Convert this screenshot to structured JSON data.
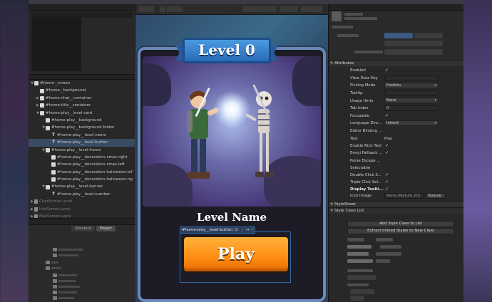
{
  "hierarchy": {
    "rows": [
      {
        "label": "#home-_screen",
        "indent": 0,
        "kind": "node",
        "arrow": "▼",
        "dim": false,
        "selected": false
      },
      {
        "label": "#home-_background",
        "indent": 1,
        "kind": "node",
        "arrow": "",
        "dim": false,
        "selected": false
      },
      {
        "label": "#home-chat__container",
        "indent": 1,
        "kind": "node",
        "arrow": "▶",
        "dim": false,
        "selected": false
      },
      {
        "label": "#home-title__container",
        "indent": 1,
        "kind": "node",
        "arrow": "▶",
        "dim": false,
        "selected": false
      },
      {
        "label": "#home-play__level-card",
        "indent": 1,
        "kind": "node",
        "arrow": "▼",
        "dim": false,
        "selected": false
      },
      {
        "label": "#home-play__background",
        "indent": 2,
        "kind": "node",
        "arrow": "",
        "dim": false,
        "selected": false
      },
      {
        "label": "#home-play__background-footer",
        "indent": 2,
        "kind": "node",
        "arrow": "▼",
        "dim": false,
        "selected": false
      },
      {
        "label": "#home-play__level-name",
        "indent": 3,
        "kind": "text",
        "arrow": "",
        "dim": false,
        "selected": false
      },
      {
        "label": "#home-play__level-button",
        "indent": 3,
        "kind": "text",
        "arrow": "",
        "dim": false,
        "selected": true
      },
      {
        "label": "#home-play__level-frame",
        "indent": 2,
        "kind": "node",
        "arrow": "▼",
        "dim": false,
        "selected": false
      },
      {
        "label": "#home-play__decoration-xmas-right",
        "indent": 3,
        "kind": "node",
        "arrow": "",
        "dim": false,
        "selected": false
      },
      {
        "label": "#home-play__decoration-xmas-left",
        "indent": 3,
        "kind": "node",
        "arrow": "",
        "dim": false,
        "selected": false
      },
      {
        "label": "#home-play__decoration-halloween-lef",
        "indent": 3,
        "kind": "node",
        "arrow": "",
        "dim": false,
        "selected": false
      },
      {
        "label": "#home-play__decoration-halloween-rig",
        "indent": 3,
        "kind": "node",
        "arrow": "",
        "dim": false,
        "selected": false
      },
      {
        "label": "#home-play__level-banner",
        "indent": 2,
        "kind": "node",
        "arrow": "▼",
        "dim": false,
        "selected": false
      },
      {
        "label": "#home-play__level-number",
        "indent": 3,
        "kind": "text",
        "arrow": "",
        "dim": false,
        "selected": false
      },
      {
        "label": "CharScreen.uxml",
        "indent": 0,
        "kind": "file",
        "arrow": "▶",
        "dim": true,
        "selected": false
      },
      {
        "label": "InfoScreen.uxml",
        "indent": 0,
        "kind": "file",
        "arrow": "▶",
        "dim": true,
        "selected": false
      },
      {
        "label": "MailScreen.uxml",
        "indent": 0,
        "kind": "file",
        "arrow": "▶",
        "dim": true,
        "selected": false
      }
    ]
  },
  "project": {
    "tabs": [
      "Standard",
      "Project"
    ]
  },
  "scene": {
    "level_title": "Level 0",
    "level_name": "Level Name",
    "play_label": "Play",
    "selection_tag": "#home-play__level-button",
    "tag_icons": [
      "⊡",
      "⋮",
      "↦",
      "⊺"
    ]
  },
  "inspector": {
    "attributes_header": "Attributes",
    "attributes": [
      {
        "label": "Enabled",
        "type": "check",
        "value": "✓"
      },
      {
        "label": "View Data Key",
        "type": "field",
        "value": ""
      },
      {
        "label": "Picking Mode",
        "type": "dropdown",
        "value": "Position"
      },
      {
        "label": "Tooltip",
        "type": "field",
        "value": ""
      },
      {
        "label": "Usage Hints",
        "type": "dropdown",
        "value": "None"
      },
      {
        "label": "Tab Index",
        "type": "field",
        "value": "0"
      },
      {
        "label": "Focusable",
        "type": "check",
        "value": "✓"
      },
      {
        "label": "Language Dire...",
        "type": "dropdown",
        "value": "Inherit"
      },
      {
        "label": "Editor Binding ...",
        "type": "none",
        "value": ""
      }
    ],
    "text_label": "Text",
    "text_value": "Play",
    "text_props": [
      {
        "label": "Enable Rich Text",
        "value": "✓",
        "bold": false
      },
      {
        "label": "Emoji Fallback ...",
        "value": "✓",
        "bold": false
      },
      {
        "label": "Parse Escape ...",
        "value": "",
        "bold": false
      },
      {
        "label": "Selectable",
        "value": "",
        "bold": false
      },
      {
        "label": "Double Click S...",
        "value": "✓",
        "bold": false
      },
      {
        "label": "Triple Click Sel...",
        "value": "✓",
        "bold": false
      },
      {
        "label": "Display Toolti...",
        "value": "✓",
        "bold": true
      }
    ],
    "icon_image_label": "Icon Image",
    "icon_image_value": "None (Texture 2D)",
    "icon_image_button": "Texture",
    "stylesheet_header": "StyleSheet",
    "style_class_list_header": "Style Class List",
    "add_class_button": "Add Style Class to List",
    "extract_button": "Extract Inlined Styles to New Class"
  }
}
